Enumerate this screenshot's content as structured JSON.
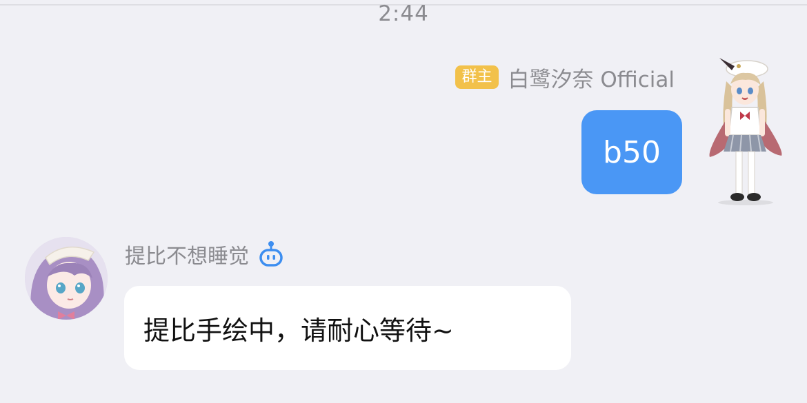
{
  "chat": {
    "timestamp": "2:44",
    "outgoing": {
      "badge": "群主",
      "sender": "白鹭汐奈 Official",
      "text": "b50",
      "avatar_icon": "anime-character-full-body"
    },
    "incoming": {
      "sender": "提比不想睡觉",
      "bot_icon": "robot-icon",
      "text": "提比手绘中，请耐心等待~",
      "avatar_icon": "anime-girl-avatar"
    }
  },
  "colors": {
    "background": "#f0f0f5",
    "outgoing_bubble": "#4a97f5",
    "incoming_bubble": "#ffffff",
    "badge": "#f2c14a",
    "bot_icon": "#3d8ef0",
    "meta_text": "#8b8b90"
  }
}
